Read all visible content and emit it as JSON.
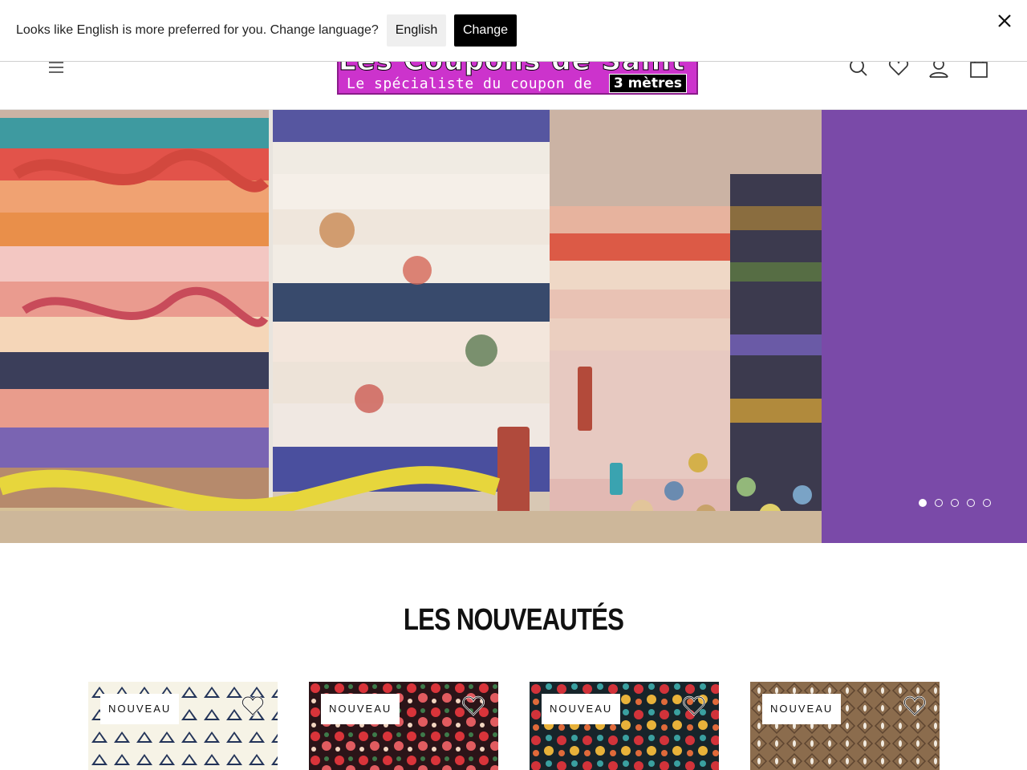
{
  "language_bar": {
    "message": "Looks like English is more preferred for you. Change language?",
    "selected_language": "English",
    "change_label": "Change"
  },
  "header": {
    "logo_title": "Les Coupons de Saint Pierre",
    "logo_subtitle": "Le spécialiste du coupon de",
    "logo_badge": "3 mètres",
    "icons": [
      "menu-icon",
      "search-icon",
      "heart-icon",
      "account-icon",
      "bag-icon"
    ]
  },
  "hero": {
    "slide_count": 5,
    "active_slide": 1,
    "accent_color": "#7a4aa8"
  },
  "new_section": {
    "title": "LES NOUVEAUTÉS",
    "products": [
      {
        "badge": "NOUVEAU"
      },
      {
        "badge": "NOUVEAU"
      },
      {
        "badge": "NOUVEAU"
      },
      {
        "badge": "NOUVEAU"
      }
    ]
  }
}
